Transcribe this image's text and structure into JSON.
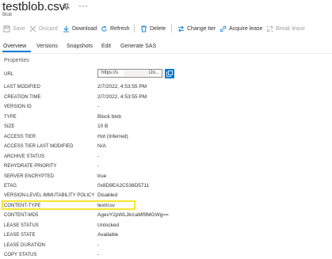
{
  "header": {
    "title": "testblob.csv",
    "subtitle": "Blob",
    "more_label": "···"
  },
  "toolbar": {
    "save": "Save",
    "discard": "Discard",
    "download": "Download",
    "refresh": "Refresh",
    "delete": "Delete",
    "change_tier": "Change tier",
    "acquire_lease": "Acquire lease",
    "break_lease": "Break lease"
  },
  "tabs": [
    "Overview",
    "Versions",
    "Snapshots",
    "Edit",
    "Generate SAS"
  ],
  "section_title": "Properties",
  "url": {
    "label": "URL",
    "prefix": "https://s",
    "suffix": "i2o..."
  },
  "properties": [
    {
      "label": "LAST MODIFIED",
      "value": "2/7/2022, 4:53:55 PM"
    },
    {
      "label": "CREATION TIME",
      "value": "2/7/2022, 4:53:55 PM"
    },
    {
      "label": "VERSION ID",
      "value": "-"
    },
    {
      "label": "TYPE",
      "value": "Block blob"
    },
    {
      "label": "SIZE",
      "value": "10 B"
    },
    {
      "label": "ACCESS TIER",
      "value": "Hot (Inferred)"
    },
    {
      "label": "ACCESS TIER LAST MODIFIED",
      "value": "N/A"
    },
    {
      "label": "ARCHIVE STATUS",
      "value": "-"
    },
    {
      "label": "REHYDRATE PRIORITY",
      "value": "-"
    },
    {
      "label": "SERVER ENCRYPTED",
      "value": "true"
    },
    {
      "label": "ETAG",
      "value": "0x8D9EA2C538D5711"
    },
    {
      "label": "VERSION-LEVEL IMMUTABILITY POLICY",
      "value": "Disabled"
    },
    {
      "label": "CONTENT-TYPE",
      "value": "text/csv"
    },
    {
      "label": "CONTENT-MD5",
      "value": "AgevY2pWLJk/caMf9MGWg=="
    },
    {
      "label": "LEASE STATUS",
      "value": "Unlocked"
    },
    {
      "label": "LEASE STATE",
      "value": "Available"
    },
    {
      "label": "LEASE DURATION",
      "value": "-"
    },
    {
      "label": "COPY STATUS",
      "value": "-"
    }
  ],
  "colors": {
    "accent": "#0078d4",
    "highlight": "#f6e431"
  }
}
